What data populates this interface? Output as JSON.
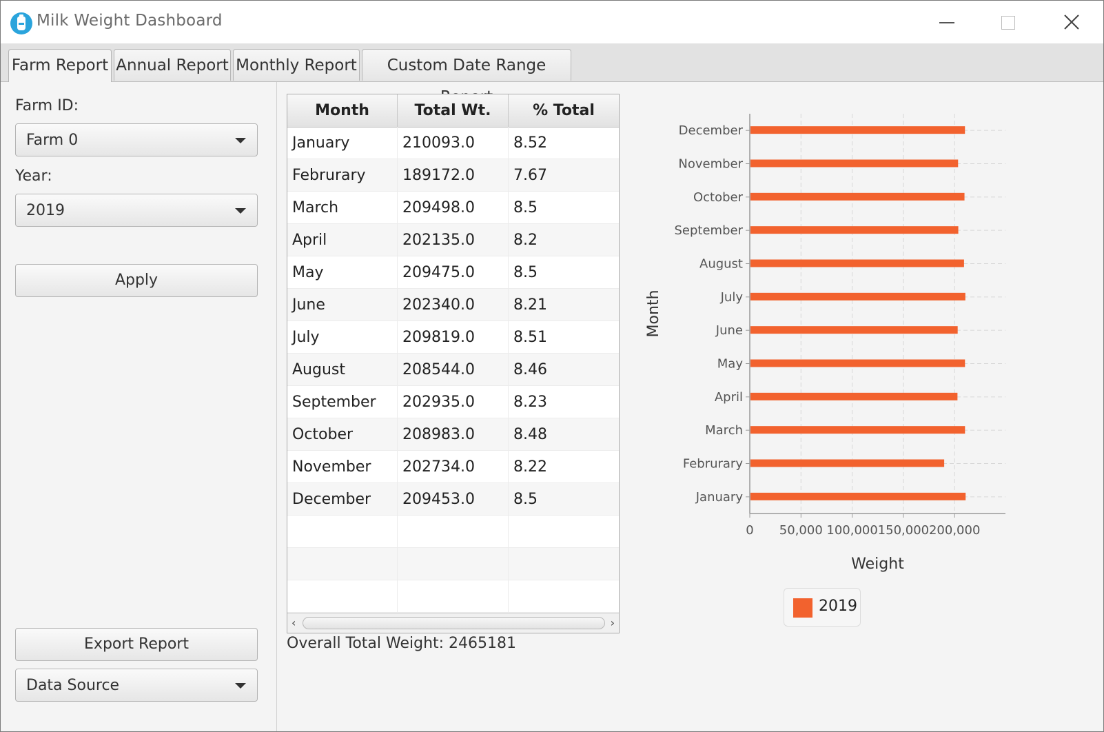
{
  "window": {
    "title": "Milk Weight Dashboard"
  },
  "tabs": [
    {
      "label": "Farm Report",
      "active": true
    },
    {
      "label": "Annual Report",
      "active": false
    },
    {
      "label": "Monthly Report",
      "active": false
    },
    {
      "label": "Custom Date Range Report",
      "active": false
    }
  ],
  "left_panel": {
    "farm_id_label": "Farm ID:",
    "farm_id_value": "Farm 0",
    "year_label": "Year:",
    "year_value": "2019",
    "apply_label": "Apply",
    "export_label": "Export Report",
    "data_source_value": "Data Source"
  },
  "table": {
    "headers": [
      "Month",
      "Total Wt.",
      "% Total"
    ],
    "rows": [
      [
        "January",
        "210093.0",
        "8.52"
      ],
      [
        "Februrary",
        "189172.0",
        "7.67"
      ],
      [
        "March",
        "209498.0",
        "8.5"
      ],
      [
        "April",
        "202135.0",
        "8.2"
      ],
      [
        "May",
        "209475.0",
        "8.5"
      ],
      [
        "June",
        "202340.0",
        "8.21"
      ],
      [
        "July",
        "209819.0",
        "8.51"
      ],
      [
        "August",
        "208544.0",
        "8.46"
      ],
      [
        "September",
        "202935.0",
        "8.23"
      ],
      [
        "October",
        "208983.0",
        "8.48"
      ],
      [
        "November",
        "202734.0",
        "8.22"
      ],
      [
        "December",
        "209453.0",
        "8.5"
      ]
    ],
    "empty_rows": 3,
    "overall_total": "Overall Total Weight: 2465181"
  },
  "chart_data": {
    "type": "bar",
    "orientation": "horizontal",
    "categories": [
      "January",
      "Februrary",
      "March",
      "April",
      "May",
      "June",
      "July",
      "August",
      "September",
      "October",
      "November",
      "December"
    ],
    "series": [
      {
        "name": "2019",
        "color": "#f2622e",
        "values": [
          210093,
          189172,
          209498,
          202135,
          209475,
          202340,
          209819,
          208544,
          202935,
          208983,
          202734,
          209453
        ]
      }
    ],
    "xlabel": "Weight",
    "ylabel": "Month",
    "xlim": [
      0,
      250000
    ],
    "x_ticks": [
      0,
      50000,
      100000,
      150000,
      200000
    ],
    "x_tick_labels": [
      "0",
      "50,000",
      "100,000",
      "150,000",
      "200,000"
    ],
    "grid": true,
    "legend_position": "bottom"
  }
}
